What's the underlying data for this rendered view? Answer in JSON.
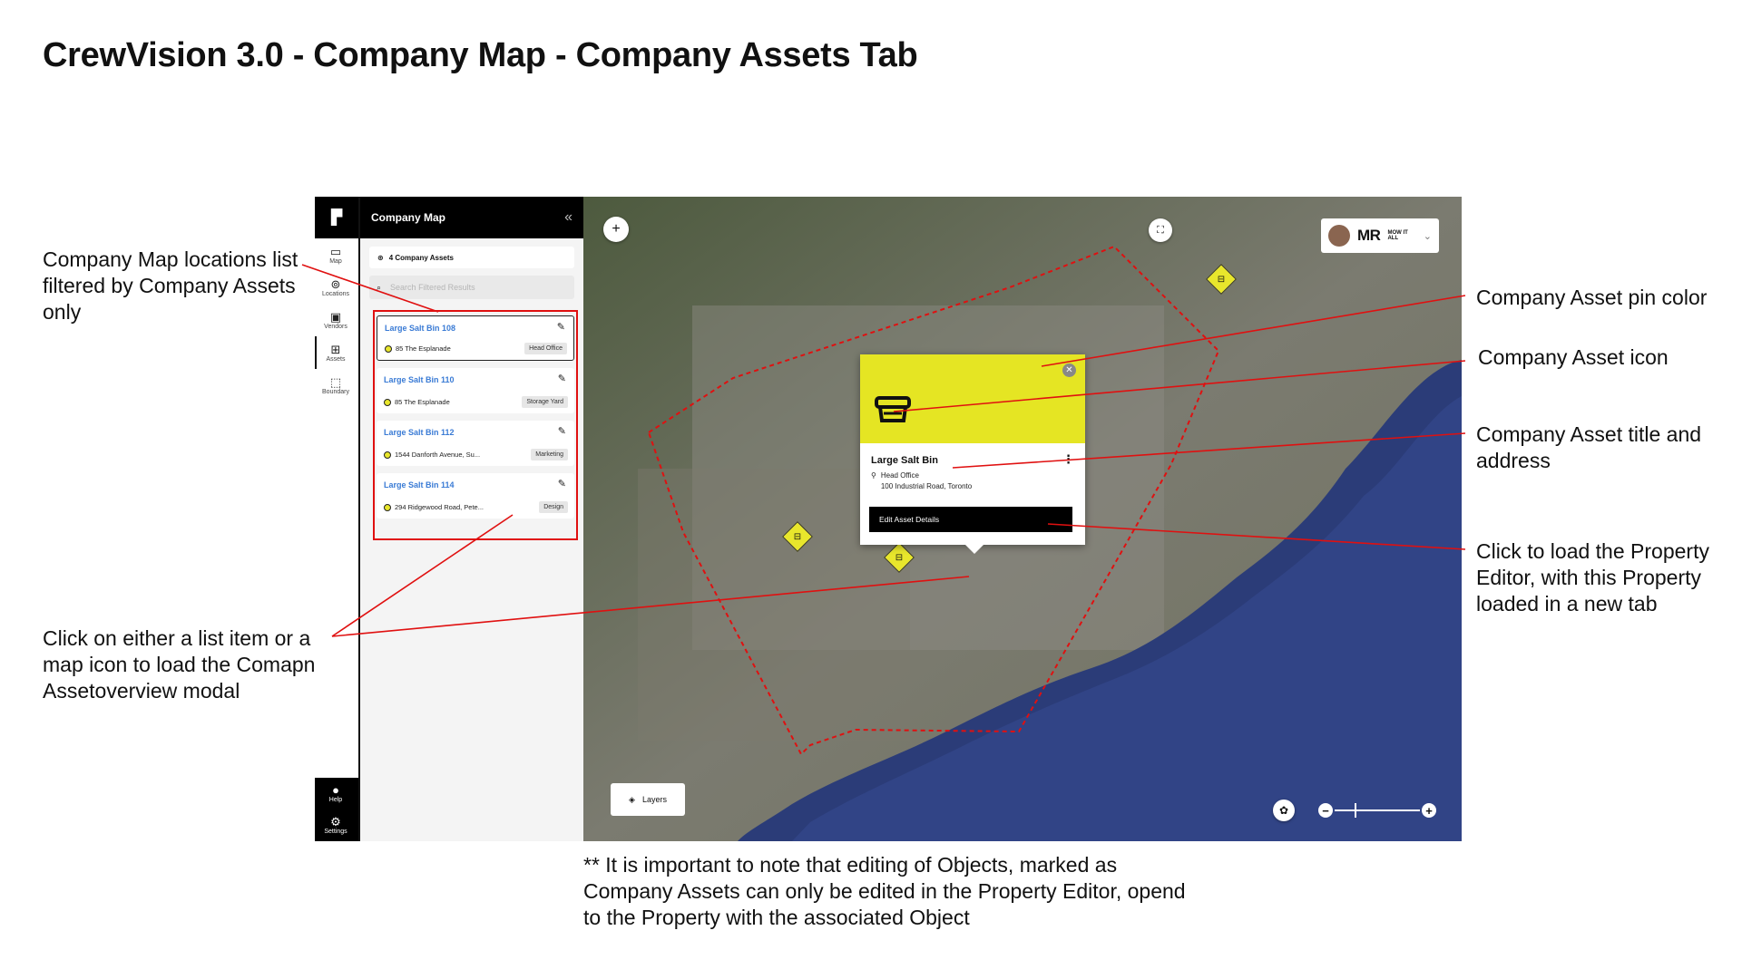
{
  "page_title": "CrewVision 3.0 - Company Map  - Company Assets Tab",
  "annotations": {
    "list_filter": "Company Map locations list filtered by Company Assets only",
    "click_item": "Click on either a list item or a map icon to load the Comapny Assetoverview modal",
    "pin_color": "Company Asset pin color",
    "asset_icon": "Company Asset icon",
    "title_address": "Company Asset title and address",
    "property_editor": "Click to load the Property Editor, with this Property loaded in a new tab"
  },
  "footnote": "** It is important to note that editing of Objects, marked as Company Assets can only be edited in the Property Editor, opend to the Property with the associated Object",
  "rail": {
    "items": [
      {
        "label": "Map",
        "icon": "map-icon"
      },
      {
        "label": "Locations",
        "icon": "locations-icon"
      },
      {
        "label": "Vendors",
        "icon": "vendors-icon"
      },
      {
        "label": "Assets",
        "icon": "assets-icon"
      },
      {
        "label": "Boundary",
        "icon": "boundary-icon"
      }
    ],
    "help": "Help",
    "settings": "Settings"
  },
  "panel": {
    "title": "Company Map",
    "filter_label": "4 Company Assets",
    "search_placeholder": "Search Filtered Results",
    "items": [
      {
        "title": "Large Salt Bin 108",
        "address": "85 The Esplanade",
        "tag": "Head Office"
      },
      {
        "title": "Large Salt Bin 110",
        "address": "85 The Esplanade",
        "tag": "Storage Yard"
      },
      {
        "title": "Large Salt Bin 112",
        "address": "1544 Danforth Avenue, Su...",
        "tag": "Marketing"
      },
      {
        "title": "Large Salt Bin 114",
        "address": "294 Ridgewood Road, Pete...",
        "tag": "Design"
      }
    ]
  },
  "map": {
    "brand": "MR",
    "brand_small": "MOW IT ALL",
    "layers_label": "Layers",
    "pin_color": "#e8e62c",
    "boundary_color": "#e01010"
  },
  "modal": {
    "title": "Large Salt Bin",
    "location_name": "Head Office",
    "address": "100 Industrial Road, Toronto",
    "button_label": "Edit Asset Details"
  }
}
